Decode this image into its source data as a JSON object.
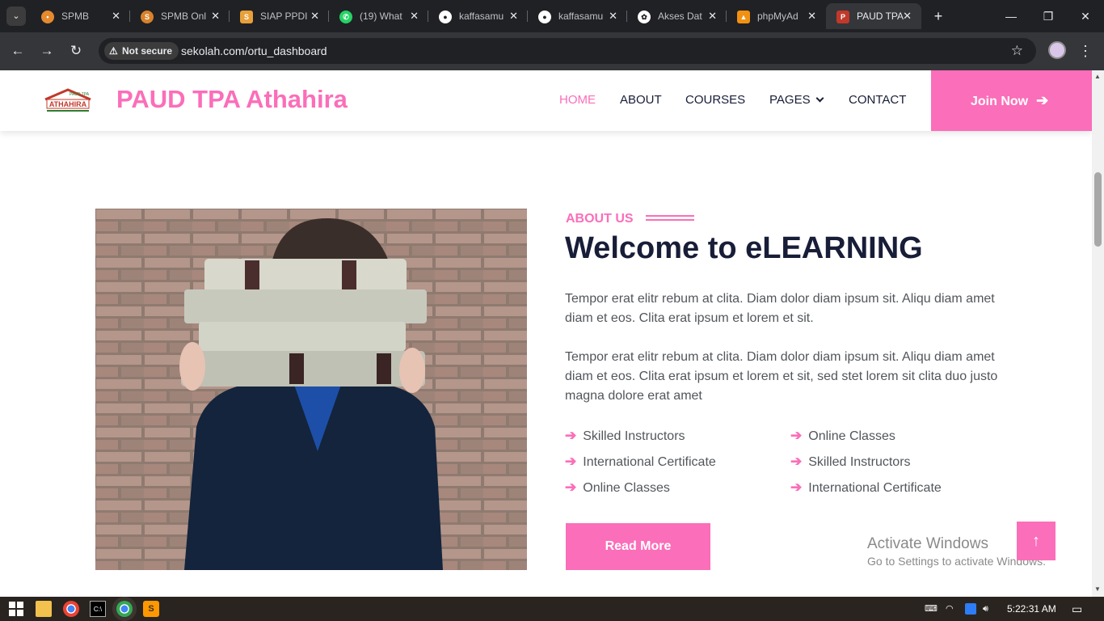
{
  "browser": {
    "tabs": [
      {
        "title": "SPMB",
        "icon": "spmb-favicon-icon",
        "color": "#e58a2f"
      },
      {
        "title": "SPMB Onl",
        "icon": "spmb-online-favicon-icon",
        "color": "#d9822b"
      },
      {
        "title": "SIAP PPDI",
        "icon": "siap-favicon-icon",
        "color": "#e8a03a"
      },
      {
        "title": "(19) What",
        "icon": "whatsapp-icon",
        "color": "#25d366"
      },
      {
        "title": "kaffasamu",
        "icon": "github-icon",
        "color": "#ffffff"
      },
      {
        "title": "kaffasamu",
        "icon": "github-icon",
        "color": "#ffffff"
      },
      {
        "title": "Akses Dat",
        "icon": "chatgpt-icon",
        "color": "#ffffff"
      },
      {
        "title": "phpMyAd",
        "icon": "phpmyadmin-icon",
        "color": "#f29111"
      },
      {
        "title": "PAUD TPA",
        "icon": "paud-favicon-icon",
        "color": "#c0392b"
      }
    ],
    "security_label": "Not secure",
    "url": "sekolah.com/ortu_dashboard"
  },
  "site": {
    "brand": "PAUD TPA Athahira",
    "logo_text": "ATHAHIRA",
    "logo_subtext": "PAUD TPA",
    "nav": [
      {
        "label": "HOME",
        "active": true
      },
      {
        "label": "ABOUT",
        "active": false
      },
      {
        "label": "COURSES",
        "active": false
      },
      {
        "label": "PAGES",
        "active": false
      },
      {
        "label": "CONTACT",
        "active": false
      }
    ],
    "join_label": "Join Now",
    "accent": "#fb6eb9",
    "dark": "#181d38"
  },
  "about": {
    "eyebrow": "ABOUT US",
    "heading": "Welcome to eLEARNING",
    "para1": "Tempor erat elitr rebum at clita. Diam dolor diam ipsum sit. Aliqu diam amet diam et eos. Clita erat ipsum et lorem et sit.",
    "para2": "Tempor erat elitr rebum at clita. Diam dolor diam ipsum sit. Aliqu diam amet diam et eos. Clita erat ipsum et lorem et sit, sed stet lorem sit clita duo justo magna dolore erat amet",
    "features": [
      "Skilled Instructors",
      "Online Classes",
      "International Certificate",
      "Skilled Instructors",
      "Online Classes",
      "International Certificate"
    ],
    "read_more": "Read More",
    "back_to_top": "↑"
  },
  "watermark": {
    "line1": "Activate Windows",
    "line2": "Go to Settings to activate Windows."
  },
  "taskbar": {
    "clock": "5:22:31 AM"
  }
}
